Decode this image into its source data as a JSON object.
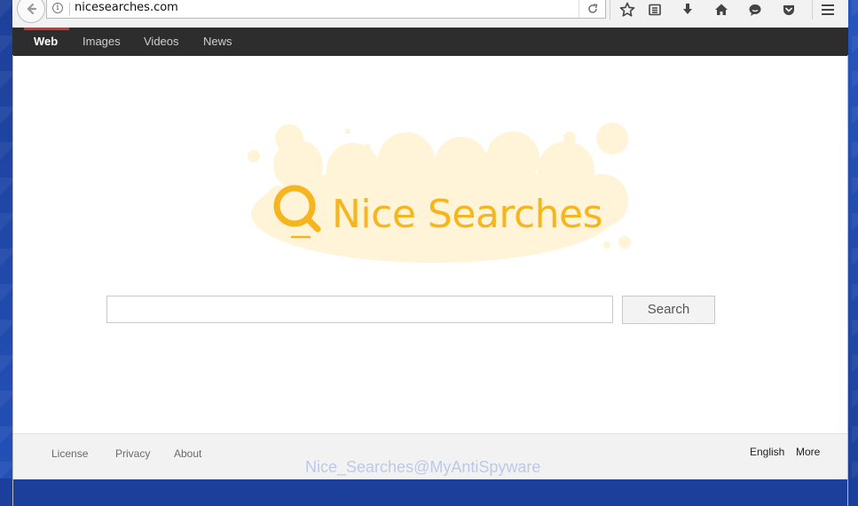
{
  "browser": {
    "url": "nicesearches.com",
    "icons": [
      "back-icon",
      "info-icon",
      "reload-icon",
      "bookmark-star-icon",
      "reading-list-icon",
      "download-icon",
      "home-icon",
      "chat-icon",
      "pocket-icon",
      "menu-icon"
    ]
  },
  "nav": {
    "items": [
      {
        "label": "Web",
        "active": true
      },
      {
        "label": "Images",
        "active": false
      },
      {
        "label": "Videos",
        "active": false
      },
      {
        "label": "News",
        "active": false
      }
    ]
  },
  "logo": {
    "text": "Nice Searches",
    "color": "#f6b51e",
    "blob_color": "#fff4d8"
  },
  "search": {
    "value": "",
    "placeholder": "",
    "button_label": "Search"
  },
  "footer": {
    "left_links": [
      "License",
      "Privacy",
      "About"
    ],
    "right_links": [
      "English",
      "More"
    ]
  },
  "watermark": "Nice_Searches@MyAntiSpyware"
}
